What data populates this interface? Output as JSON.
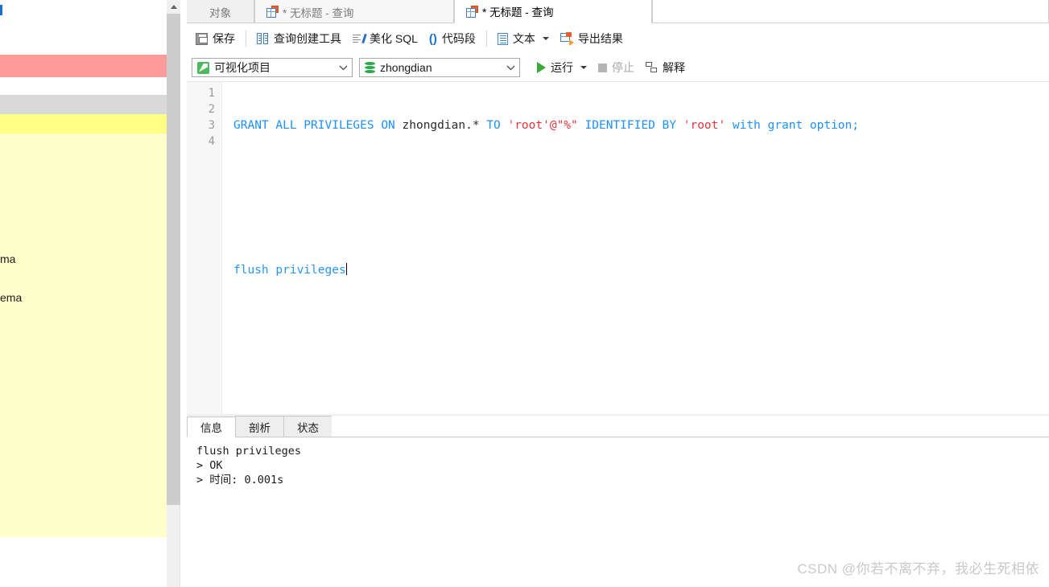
{
  "left_panel": {
    "fragment_1": "ma",
    "fragment_2": "ema",
    "colors": {
      "red_band": "#ff9b9b",
      "gray_band": "#d9d9d9",
      "yellow_band": "#ffff85",
      "light_yellow_band": "#ffffcc"
    }
  },
  "tabs": [
    {
      "label": "对象",
      "active": false
    },
    {
      "label": "* 无标题 - 查询",
      "active": false
    },
    {
      "label": "* 无标题 - 查询",
      "active": true
    }
  ],
  "toolbar": {
    "save_label": "保存",
    "query_builder_label": "查询创建工具",
    "beautify_label": "美化 SQL",
    "snippet_label": "代码段",
    "text_label": "文本",
    "export_label": "导出结果"
  },
  "selectors": {
    "project": "可视化项目",
    "database": "zhongdian",
    "run_label": "运行",
    "stop_label": "停止",
    "explain_label": "解释"
  },
  "editor": {
    "line_numbers": [
      "1",
      "2",
      "3",
      "4"
    ],
    "line1": {
      "k_grant": "GRANT ALL PRIVILEGES ON ",
      "p_target": "zhongdian.*",
      "k_to": " TO ",
      "s_user": "'root'@\"%\"",
      "k_identified": " IDENTIFIED BY ",
      "s_pass": "'root'",
      "k_tail": " with grant option;"
    },
    "line4": "flush privileges"
  },
  "result": {
    "tabs": [
      "信息",
      "剖析",
      "状态"
    ],
    "active_tab": "信息",
    "output": "flush privileges\n> OK\n> 时间: 0.001s"
  },
  "watermark": "CSDN @你若不离不弃，我必生死相依"
}
